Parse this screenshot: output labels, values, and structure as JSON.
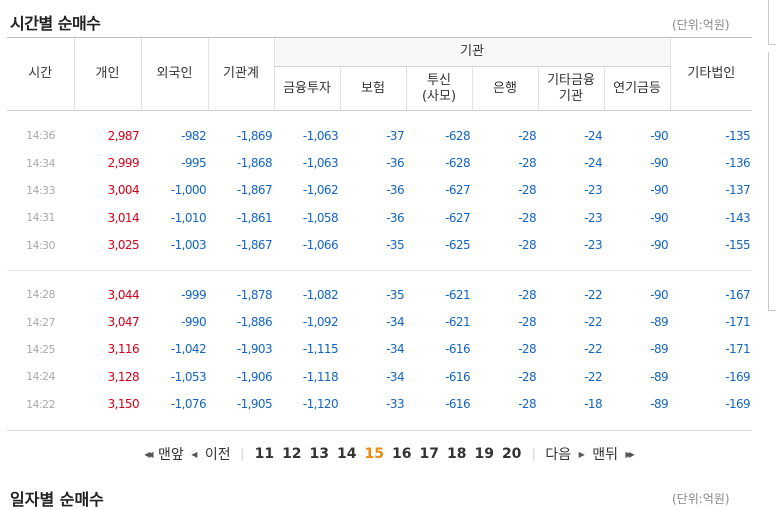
{
  "title": "시간별 순매수",
  "unit_label": "(단위:억원)",
  "headers": {
    "time": "시간",
    "individual": "개인",
    "foreign": "외국인",
    "institution_total": "기관계",
    "institution": "기관",
    "financial_invest": "금융투자",
    "insurance": "보험",
    "trust": "투신\n(사모)",
    "bank": "은행",
    "other_financial": "기타금융\n기관",
    "pension": "연기금등",
    "other_corp": "기타법인"
  },
  "group1": [
    [
      "14:36",
      "2,987",
      "-982",
      "-1,869",
      "-1,063",
      "-37",
      "-628",
      "-28",
      "-24",
      "-90",
      "-135"
    ],
    [
      "14:34",
      "2,999",
      "-995",
      "-1,868",
      "-1,063",
      "-36",
      "-628",
      "-28",
      "-24",
      "-90",
      "-136"
    ],
    [
      "14:33",
      "3,004",
      "-1,000",
      "-1,867",
      "-1,062",
      "-36",
      "-627",
      "-28",
      "-23",
      "-90",
      "-137"
    ],
    [
      "14:31",
      "3,014",
      "-1,010",
      "-1,861",
      "-1,058",
      "-36",
      "-627",
      "-28",
      "-23",
      "-90",
      "-143"
    ],
    [
      "14:30",
      "3,025",
      "-1,003",
      "-1,867",
      "-1,066",
      "-35",
      "-625",
      "-28",
      "-23",
      "-90",
      "-155"
    ]
  ],
  "group2": [
    [
      "14:28",
      "3,044",
      "-999",
      "-1,878",
      "-1,082",
      "-35",
      "-621",
      "-28",
      "-22",
      "-90",
      "-167"
    ],
    [
      "14:27",
      "3,047",
      "-990",
      "-1,886",
      "-1,092",
      "-34",
      "-621",
      "-28",
      "-22",
      "-89",
      "-171"
    ],
    [
      "14:25",
      "3,116",
      "-1,042",
      "-1,903",
      "-1,115",
      "-34",
      "-616",
      "-28",
      "-22",
      "-89",
      "-171"
    ],
    [
      "14:24",
      "3,128",
      "-1,053",
      "-1,906",
      "-1,118",
      "-34",
      "-616",
      "-28",
      "-22",
      "-89",
      "-169"
    ],
    [
      "14:22",
      "3,150",
      "-1,076",
      "-1,905",
      "-1,120",
      "-33",
      "-616",
      "-28",
      "-18",
      "-89",
      "-169"
    ]
  ],
  "pager": {
    "first": "맨앞",
    "prev": "이전",
    "pages": [
      "11",
      "12",
      "13",
      "14",
      "15",
      "16",
      "17",
      "18",
      "19",
      "20"
    ],
    "current": "15",
    "next": "다음",
    "last": "맨뒤"
  },
  "next_section": {
    "title": "일자별 순매수",
    "unit_label": "(단위:억원)"
  },
  "colors": {
    "positive": "#d0021b",
    "negative": "#1565c0",
    "active_page": "#ea8a10"
  }
}
